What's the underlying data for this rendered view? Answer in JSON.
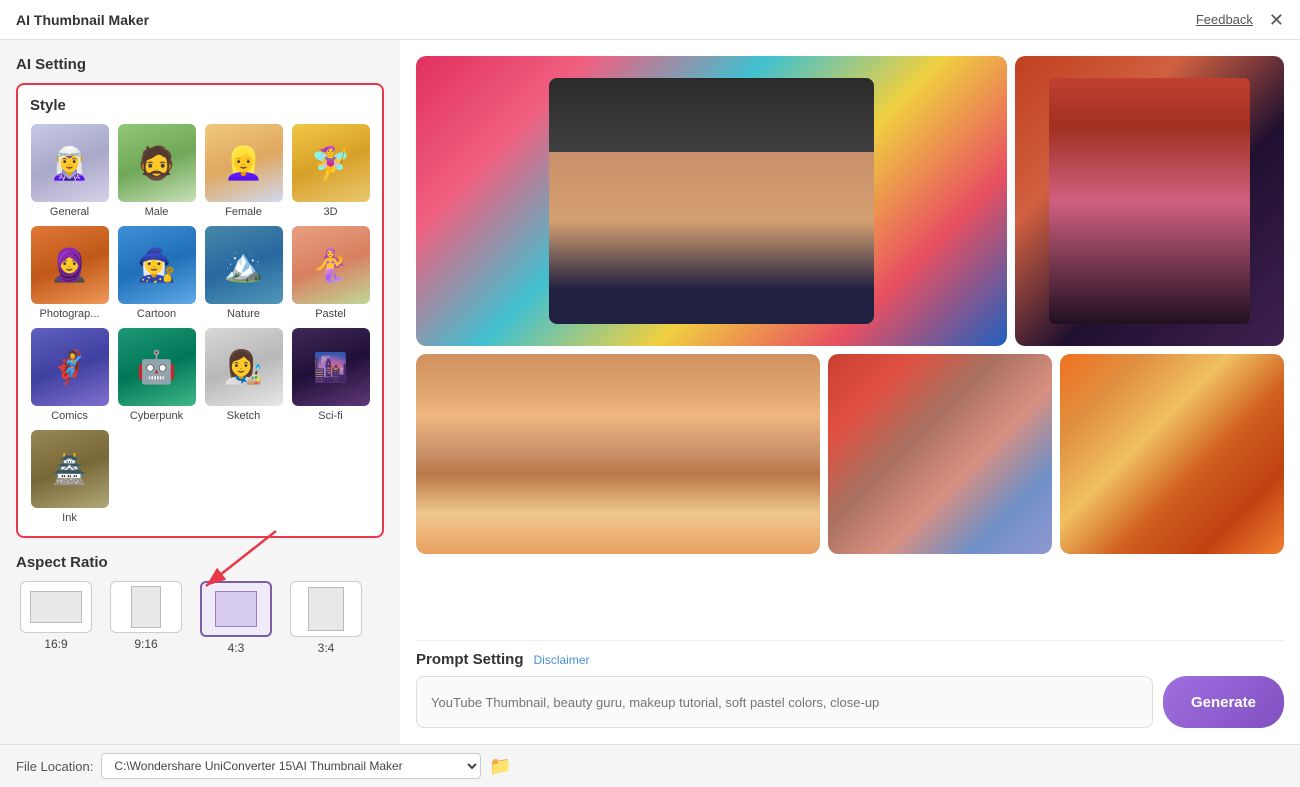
{
  "titlebar": {
    "title": "AI Thumbnail Maker",
    "feedback_label": "Feedback",
    "close_icon": "✕"
  },
  "left_panel": {
    "ai_setting_label": "AI Setting",
    "style_section_label": "Style",
    "styles": [
      {
        "id": "general",
        "label": "General",
        "thumb_class": "general-face"
      },
      {
        "id": "male",
        "label": "Male",
        "thumb_class": "male-face"
      },
      {
        "id": "female",
        "label": "Female",
        "thumb_class": "female-face"
      },
      {
        "id": "3d",
        "label": "3D",
        "thumb_class": "threed-face"
      },
      {
        "id": "photography",
        "label": "Photograp...",
        "thumb_class": "photo-face"
      },
      {
        "id": "cartoon",
        "label": "Cartoon",
        "thumb_class": "cartoon-face"
      },
      {
        "id": "nature",
        "label": "Nature",
        "thumb_class": "nature-face"
      },
      {
        "id": "pastel",
        "label": "Pastel",
        "thumb_class": "pastel-face"
      },
      {
        "id": "comics",
        "label": "Comics",
        "thumb_class": "comics-face"
      },
      {
        "id": "cyberpunk",
        "label": "Cyberpunk",
        "thumb_class": "cyberpunk-face"
      },
      {
        "id": "sketch",
        "label": "Sketch",
        "thumb_class": "sketch-face"
      },
      {
        "id": "scifi",
        "label": "Sci-fi",
        "thumb_class": "scifi-face"
      },
      {
        "id": "ink",
        "label": "Ink",
        "thumb_class": "ink-face"
      }
    ],
    "aspect_ratio_label": "Aspect Ratio",
    "aspect_ratios": [
      {
        "id": "16:9",
        "label": "16:9",
        "selected": false
      },
      {
        "id": "9:16",
        "label": "9:16",
        "selected": false
      },
      {
        "id": "4:3",
        "label": "4:3",
        "selected": true
      },
      {
        "id": "3:4",
        "label": "3:4",
        "selected": false
      }
    ]
  },
  "right_panel": {
    "prompt_setting_label": "Prompt Setting",
    "disclaimer_label": "Disclaimer",
    "prompt_placeholder": "YouTube Thumbnail, beauty guru, makeup tutorial, soft pastel colors, close-up",
    "generate_button_label": "Generate",
    "file_location_label": "File Location:",
    "file_location_value": "C:\\Wondershare UniConverter 15\\AI Thumbnail Maker",
    "folder_icon": "📁"
  }
}
